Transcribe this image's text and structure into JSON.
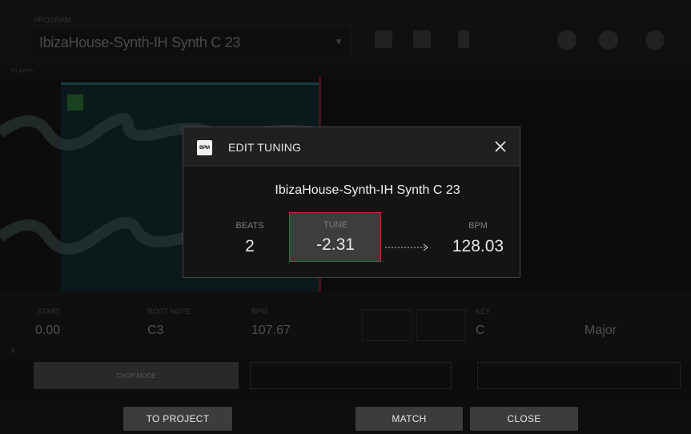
{
  "background": {
    "program_label": "PROGRAM",
    "program_name": "IbizaHouse-Synth-IH Synth C 23",
    "track_label": "IH Synth",
    "params": {
      "start_label": "START",
      "start_value": "0.00",
      "root_label": "ROOT NOTE",
      "root_value": "C3",
      "bpm_label": "BPM",
      "bpm_value": "107.67",
      "key_label": "KEY",
      "key_value": "C",
      "scale_value": "Major"
    },
    "chop_label": "CHOP MODE"
  },
  "modal": {
    "icon_text": "BPM",
    "title": "EDIT TUNING",
    "sample_name": "IbizaHouse-Synth-IH Synth C 23",
    "beats_label": "BEATS",
    "beats_value": "2",
    "tune_label": "TUNE",
    "tune_value": "-2.31",
    "bpm_label": "BPM",
    "bpm_value": "128.03"
  },
  "bottom": {
    "to_project": "TO PROJECT",
    "match": "MATCH",
    "close": "CLOSE"
  },
  "colors": {
    "accent_red": "#c4283d",
    "region_teal": "#2aa9b0",
    "button_gray": "#3c3c3c"
  }
}
